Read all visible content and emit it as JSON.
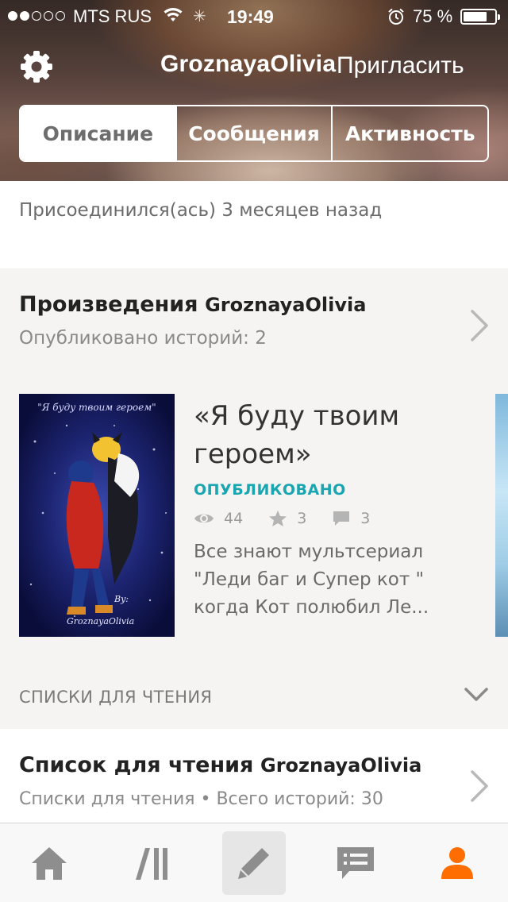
{
  "status_bar": {
    "carrier": "MTS RUS",
    "time": "19:49",
    "battery_percent": "75 %",
    "battery_level": 0.75,
    "signal_bars_filled": 2,
    "signal_bars_total": 5
  },
  "header": {
    "username": "GroznayaOlivia",
    "invite_label": "Пригласить",
    "settings_icon": "gear-icon"
  },
  "tabs": [
    {
      "label": "Описание",
      "selected": true
    },
    {
      "label": "Сообщения",
      "selected": false
    },
    {
      "label": "Активность",
      "selected": false
    }
  ],
  "profile": {
    "joined_text": "Присоединился(ась) 3 месяцев назад"
  },
  "works": {
    "title": "Произведения",
    "username": "GroznayaOlivia",
    "subtitle": "Опубликовано историй: 2",
    "story": {
      "title": "«Я буду твоим героем»",
      "cover_text": "\"Я буду твоим героем\"",
      "status": "ОПУБЛИКОВАНО",
      "views": "44",
      "votes": "3",
      "comments": "3",
      "description": "Все знают мультсериал \"Леди баг и Супер кот \" когда Кот полюбил Ле..."
    }
  },
  "reading_lists": {
    "section_label": "СПИСКИ ДЛЯ ЧТЕНИЯ",
    "title": "Список для чтения",
    "username": "GroznayaOlivia",
    "subtitle": "Списки для чтения • Всего историй: 30"
  },
  "tabbar": {
    "items": [
      "home-icon",
      "library-icon",
      "write-icon",
      "messages-icon",
      "profile-icon"
    ],
    "active": "profile-icon",
    "highlighted": "write-icon"
  },
  "colors": {
    "accent_orange": "#ff6d00",
    "published_teal": "#1aa6b0",
    "tab_icon_gray": "#8e8e8e"
  }
}
